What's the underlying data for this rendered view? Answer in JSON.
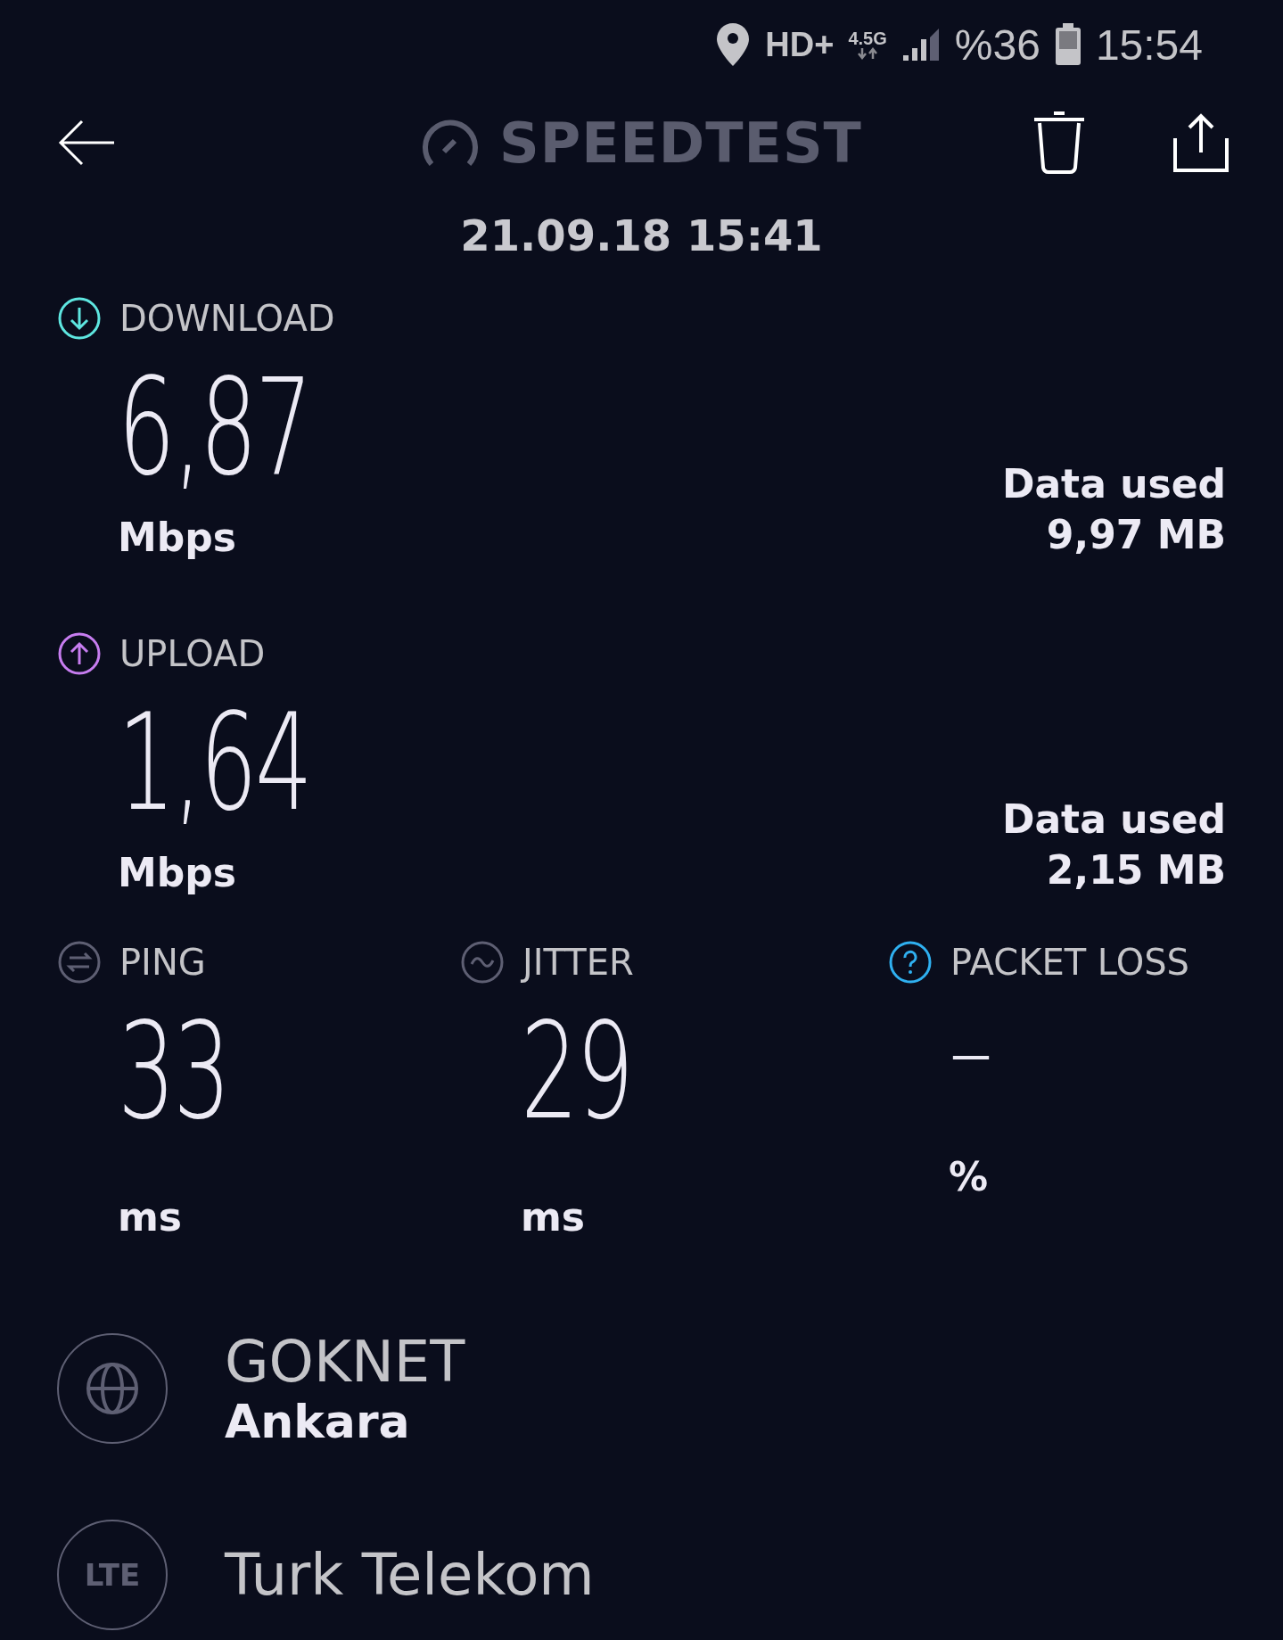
{
  "status_bar": {
    "network": "HD+",
    "network_type": "4.5G",
    "battery": "%36",
    "time": "15:54"
  },
  "header": {
    "title": "SPEEDTEST",
    "date": "21.09.18 15:41"
  },
  "results": [
    {
      "kind": "download",
      "label": "DOWNLOAD",
      "value": "6,87",
      "unit": "Mbps",
      "color": "#5ee6e0",
      "data_used_label": "Data used",
      "data_used": "9,97 MB"
    },
    {
      "kind": "upload",
      "label": "UPLOAD",
      "value": "1,64",
      "unit": "Mbps",
      "color": "#c77df0",
      "data_used_label": "Data used",
      "data_used": "2,15 MB"
    }
  ],
  "metrics": [
    {
      "kind": "ping",
      "label": "PING",
      "value": "33",
      "unit": "ms",
      "color": "#5e5f73"
    },
    {
      "kind": "jitter",
      "label": "JITTER",
      "value": "29",
      "unit": "ms",
      "color": "#5e5f73"
    },
    {
      "kind": "packet_loss",
      "label": "PACKET LOSS",
      "value": "–",
      "unit": "%",
      "color": "#2fb0f0"
    }
  ],
  "server": {
    "name": "GOKNET",
    "location": "Ankara"
  },
  "provider": {
    "badge": "LTE",
    "name": "Turk Telekom"
  }
}
